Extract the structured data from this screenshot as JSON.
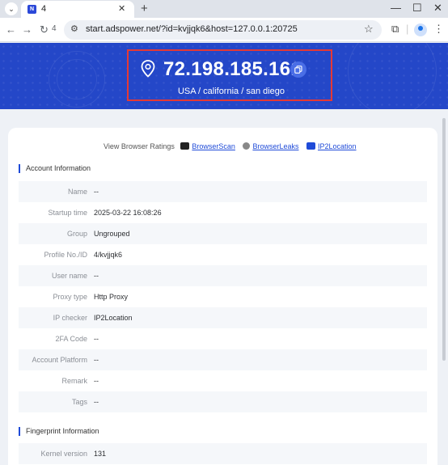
{
  "browser": {
    "tab_title": "4",
    "tab_favicon_letter": "N",
    "url": "start.adspower.net/?id=kvjjqk6&host=127.0.0.1:20725",
    "tab_count_label": "4"
  },
  "header": {
    "ip": "72.198.185.161",
    "location": "USA / california / san diego",
    "brand_color": "#2447c8",
    "highlight_color": "#e53935"
  },
  "ratings": {
    "label": "View Browser Ratings",
    "links": [
      "BrowserScan",
      "BrowserLeaks",
      "IP2Location"
    ]
  },
  "account": {
    "title": "Account Information",
    "rows": [
      {
        "label": "Name",
        "value": "--"
      },
      {
        "label": "Startup time",
        "value": "2025-03-22 16:08:26"
      },
      {
        "label": "Group",
        "value": "Ungrouped"
      },
      {
        "label": "Profile No./ID",
        "value": "4/kvjjqk6"
      },
      {
        "label": "User name",
        "value": "--"
      },
      {
        "label": "Proxy type",
        "value": "Http Proxy"
      },
      {
        "label": "IP checker",
        "value": "IP2Location"
      },
      {
        "label": "2FA Code",
        "value": "--"
      },
      {
        "label": "Account Platform",
        "value": "--"
      },
      {
        "label": "Remark",
        "value": "--"
      },
      {
        "label": "Tags",
        "value": "--"
      }
    ]
  },
  "fingerprint": {
    "title": "Fingerprint Information",
    "rows": [
      {
        "label": "Kernel version",
        "value": "131"
      }
    ]
  }
}
